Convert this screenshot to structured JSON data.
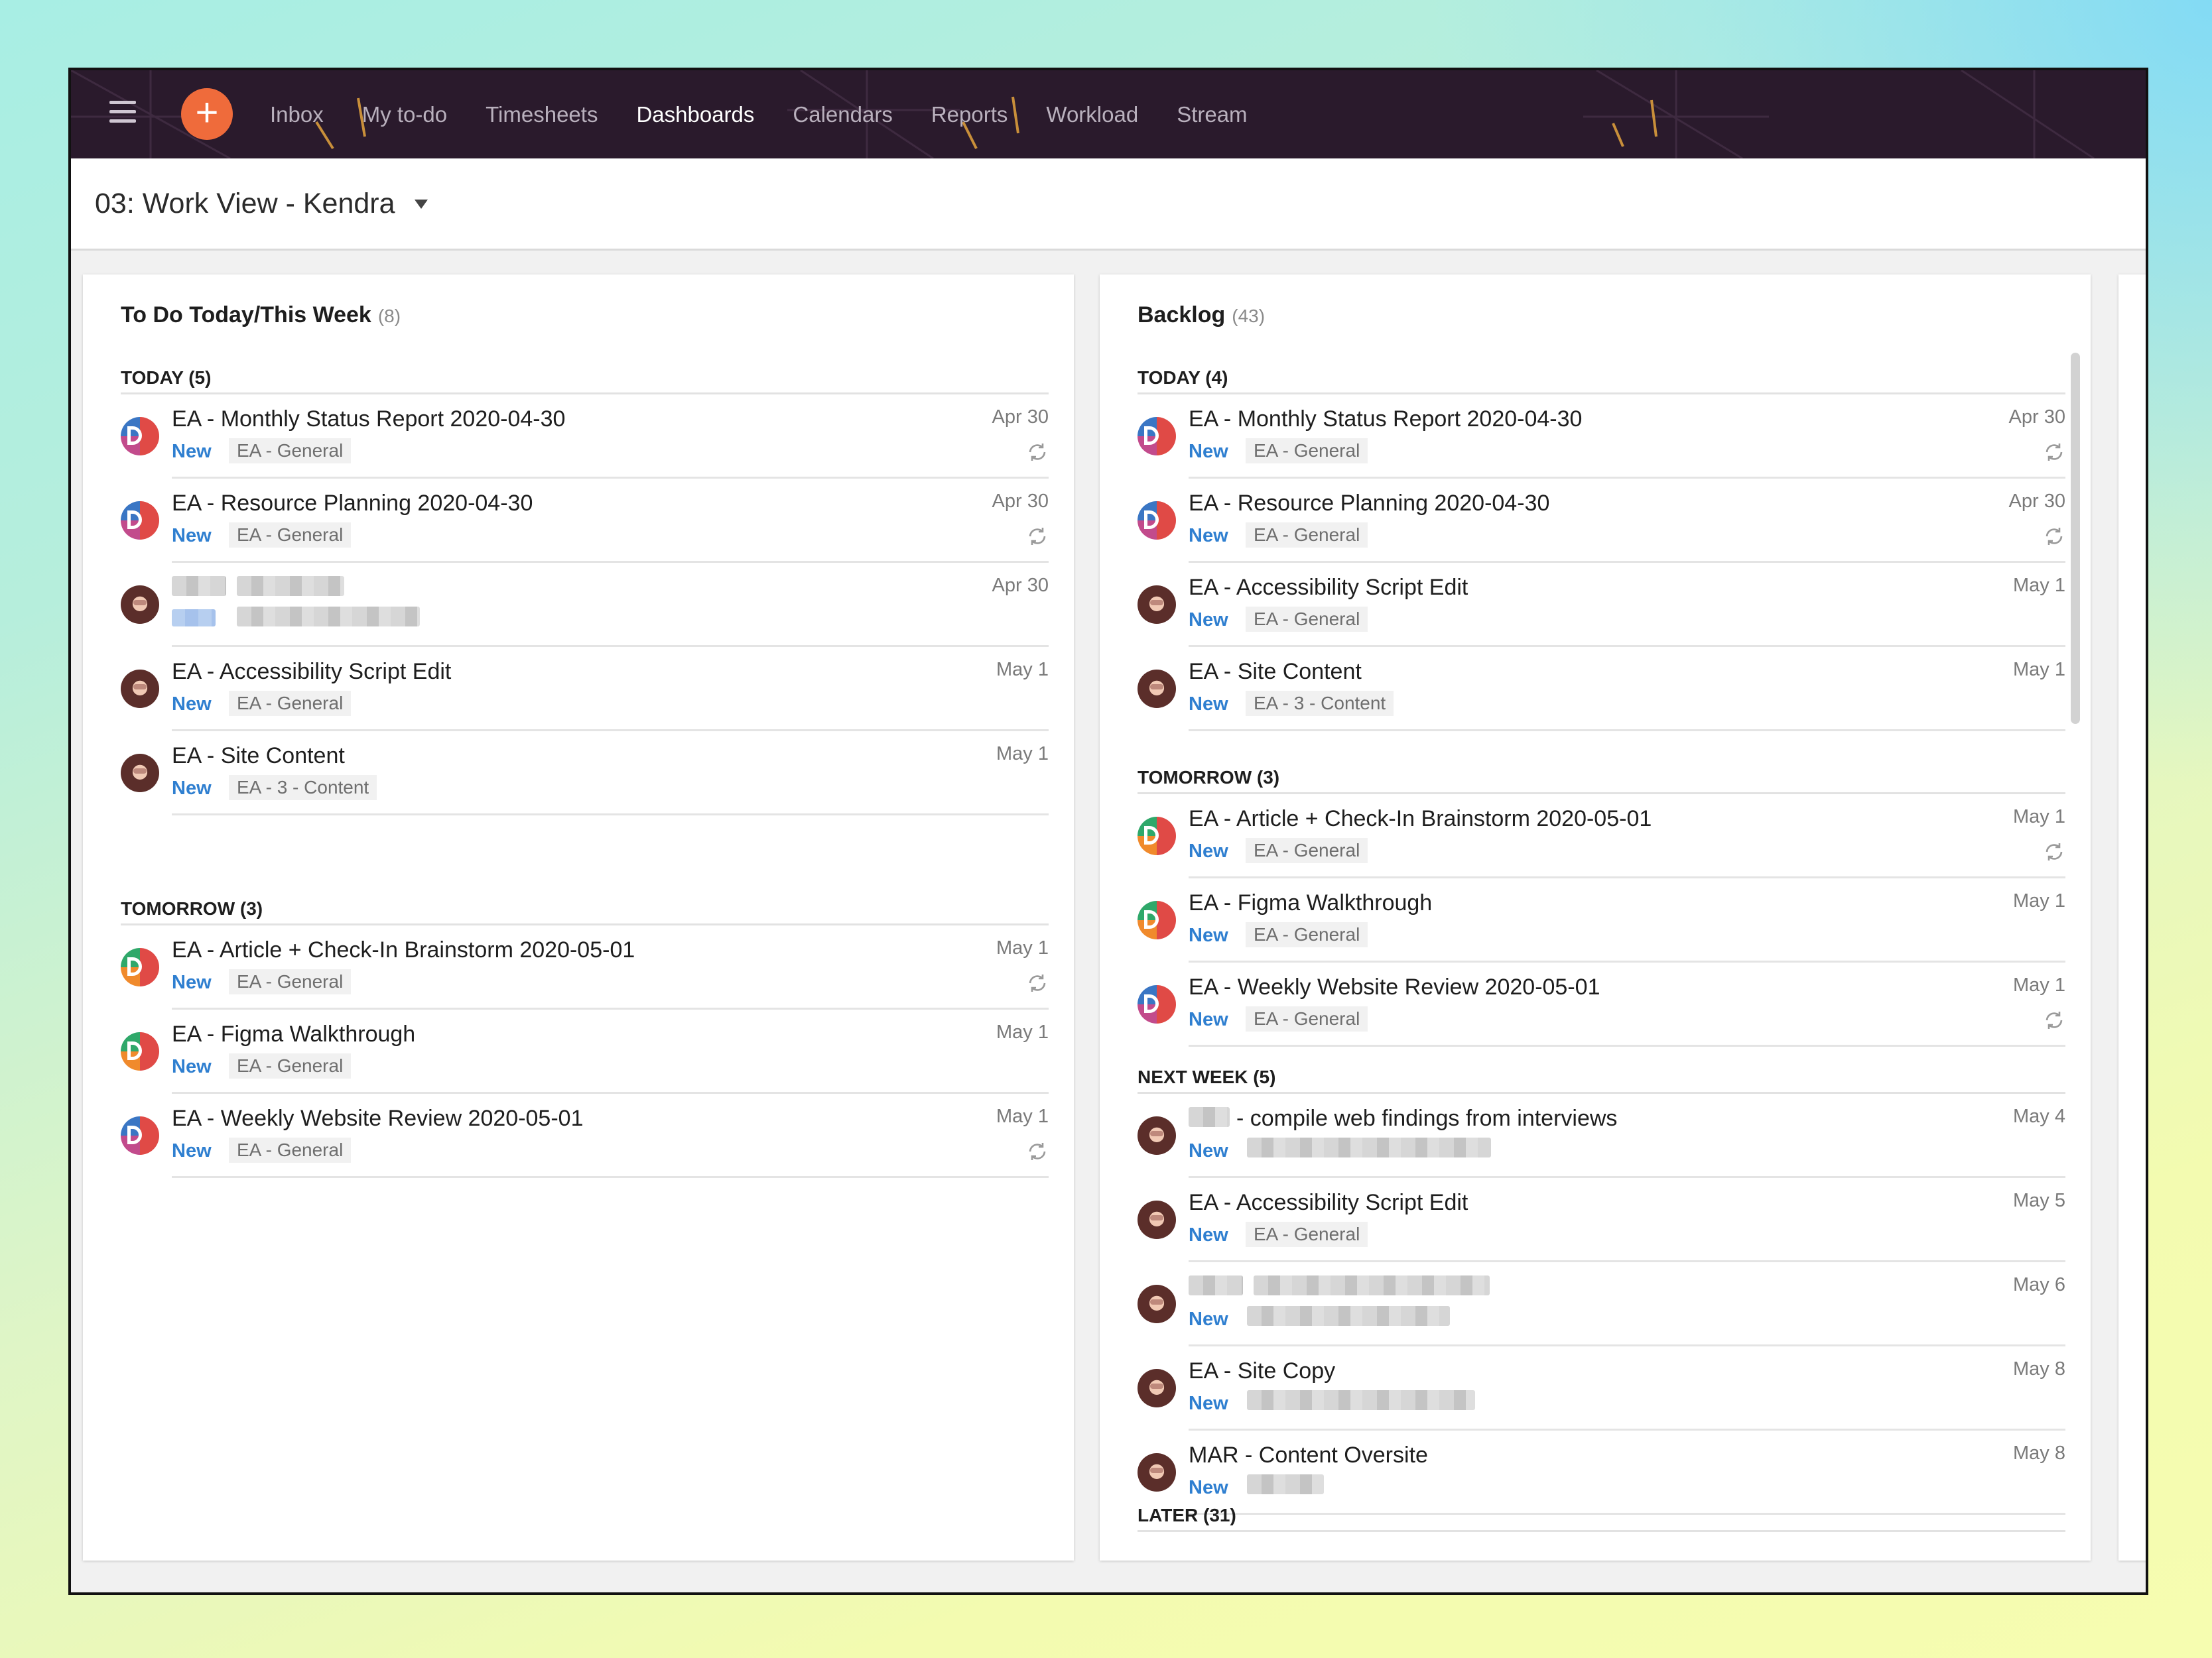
{
  "topbar": {
    "nav": [
      "Inbox",
      "My to-do",
      "Timesheets",
      "Dashboards",
      "Calendars",
      "Reports",
      "Workload",
      "Stream"
    ],
    "active": "Dashboards",
    "add_label": "+"
  },
  "page": {
    "title": "03: Work View - Kendra"
  },
  "left_panel": {
    "title": "To Do Today/This Week",
    "count": "(8)",
    "sections": [
      {
        "label": "TODAY (5)",
        "tasks": [
          {
            "title": "EA - Monthly Status Report 2020-04-30",
            "status": "New",
            "tag": "EA - General",
            "date": "Apr 30"
          },
          {
            "title": "EA - Resource Planning 2020-04-30",
            "status": "New",
            "tag": "EA - General",
            "date": "Apr 30"
          },
          {
            "title": "",
            "status": "",
            "tag": "",
            "date": "Apr 30"
          },
          {
            "title": "EA - Accessibility Script Edit",
            "status": "New",
            "tag": "EA - General",
            "date": "May 1"
          },
          {
            "title": "EA - Site Content",
            "status": "New",
            "tag": "EA - 3 - Content",
            "date": "May 1"
          }
        ]
      },
      {
        "label": "TOMORROW (3)",
        "tasks": [
          {
            "title": "EA - Article + Check-In Brainstorm 2020-05-01",
            "status": "New",
            "tag": "EA - General",
            "date": "May 1"
          },
          {
            "title": "EA - Figma Walkthrough",
            "status": "New",
            "tag": "EA - General",
            "date": "May 1"
          },
          {
            "title": "EA - Weekly Website Review 2020-05-01",
            "status": "New",
            "tag": "EA - General",
            "date": "May 1"
          }
        ]
      }
    ]
  },
  "right_panel": {
    "title": "Backlog",
    "count": "(43)",
    "sections": [
      {
        "label": "TODAY (4)",
        "tasks": [
          {
            "title": "EA - Monthly Status Report 2020-04-30",
            "status": "New",
            "tag": "EA - General",
            "date": "Apr 30"
          },
          {
            "title": "EA - Resource Planning 2020-04-30",
            "status": "New",
            "tag": "EA - General",
            "date": "Apr 30"
          },
          {
            "title": "EA - Accessibility Script Edit",
            "status": "New",
            "tag": "EA - General",
            "date": "May 1"
          },
          {
            "title": "EA - Site Content",
            "status": "New",
            "tag": "EA - 3 - Content",
            "date": "May 1"
          }
        ]
      },
      {
        "label": "TOMORROW (3)",
        "tasks": [
          {
            "title": "EA - Article + Check-In Brainstorm 2020-05-01",
            "status": "New",
            "tag": "EA - General",
            "date": "May 1"
          },
          {
            "title": "EA - Figma Walkthrough",
            "status": "New",
            "tag": "EA - General",
            "date": "May 1"
          },
          {
            "title": "EA - Weekly Website Review 2020-05-01",
            "status": "New",
            "tag": "EA - General",
            "date": "May 1"
          }
        ]
      },
      {
        "label": "NEXT WEEK (5)",
        "tasks": [
          {
            "title": "- compile web findings from interviews",
            "status": "New",
            "tag": "",
            "date": "May 4"
          },
          {
            "title": "EA - Accessibility Script Edit",
            "status": "New",
            "tag": "EA - General",
            "date": "May 5"
          },
          {
            "title": "",
            "status": "New",
            "tag": "",
            "date": "May 6"
          },
          {
            "title": "EA - Site Copy",
            "status": "New",
            "tag": "",
            "date": "May 8"
          },
          {
            "title": "MAR - Content Oversite",
            "status": "New",
            "tag": "",
            "date": "May 8"
          }
        ]
      },
      {
        "label": "LATER (31)",
        "tasks": []
      }
    ]
  },
  "colors": {
    "topbar": "#2a1a2c",
    "accent": "#ef6b3b",
    "status_new": "#2f7fd0"
  },
  "icons": [
    "menu-icon",
    "plus-icon",
    "dropdown-caret-icon",
    "recurring-icon",
    "avatar"
  ]
}
